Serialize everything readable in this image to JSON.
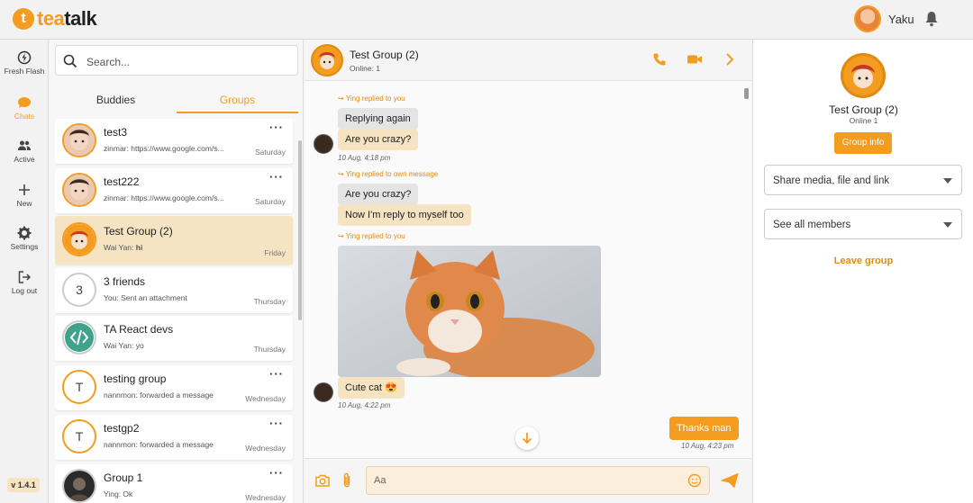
{
  "header": {
    "logo_mark": "t",
    "logo_text_1": "tea",
    "logo_text_2": "talk",
    "user_name": "Yaku",
    "accent": "#f39c1f"
  },
  "nav": {
    "items": [
      {
        "label": "Fresh Flash",
        "icon": "flash-icon"
      },
      {
        "label": "Chats",
        "icon": "chat-bubble-icon"
      },
      {
        "label": "Active",
        "icon": "people-icon"
      },
      {
        "label": "New",
        "icon": "plus-icon"
      },
      {
        "label": "Settings",
        "icon": "gear-icon"
      },
      {
        "label": "Log out",
        "icon": "logout-icon"
      }
    ],
    "version": "v 1.4.1"
  },
  "list": {
    "search_placeholder": "Search...",
    "tabs": [
      "Buddies",
      "Groups"
    ],
    "conversations": [
      {
        "name": "test3",
        "last": "zinmar: https://www.google.com/s...",
        "time": "Saturday",
        "avatar": "photo"
      },
      {
        "name": "test222",
        "last": "zinmar: https://www.google.com/s...",
        "time": "Saturday",
        "avatar": "photo"
      },
      {
        "name": "Test Group (2)",
        "last_sender": "Wai Yan:",
        "last_text": "hi",
        "time": "Friday",
        "avatar": "photo"
      },
      {
        "name": "3 friends",
        "last": "You: Sent an attachment",
        "time": "Thursday",
        "avatar": "3"
      },
      {
        "name": "TA React devs",
        "last": "Wai Yan: yo",
        "time": "Thursday",
        "avatar": "code-icon"
      },
      {
        "name": "testing group",
        "last": "nannmon: forwarded a message",
        "time": "Wednesday",
        "avatar": "T"
      },
      {
        "name": "testgp2",
        "last": "nannmon: forwarded a message",
        "time": "Wednesday",
        "avatar": "T"
      },
      {
        "name": "Group 1",
        "last": "Ying: Ok",
        "time": "Wednesday",
        "avatar": "photo"
      }
    ]
  },
  "chat": {
    "title": "Test Group (2)",
    "status": "Online: 1",
    "messages": {
      "reply1_note": "Ying replied to you",
      "reply1_quote": "Replying again",
      "reply1_text": "Are you crazy?",
      "reply1_time": "10 Aug, 4:18 pm",
      "reply2_note": "Ying replied to own message",
      "reply2_quote": "Are you crazy?",
      "reply2_text": "Now I'm reply to myself too",
      "reply3_note": "Ying replied to you",
      "reply3_text": "Cute cat 😍",
      "reply3_time": "10 Aug, 4:22 pm",
      "own_text": "Thanks man",
      "own_time": "10 Aug, 4:23 pm"
    },
    "composer_placeholder": "Aa"
  },
  "info": {
    "title": "Test Group (2)",
    "status": "Online 1",
    "button": "Group info",
    "dropdown1": "Share media, file and link",
    "dropdown2": "See all members",
    "leave": "Leave group"
  }
}
